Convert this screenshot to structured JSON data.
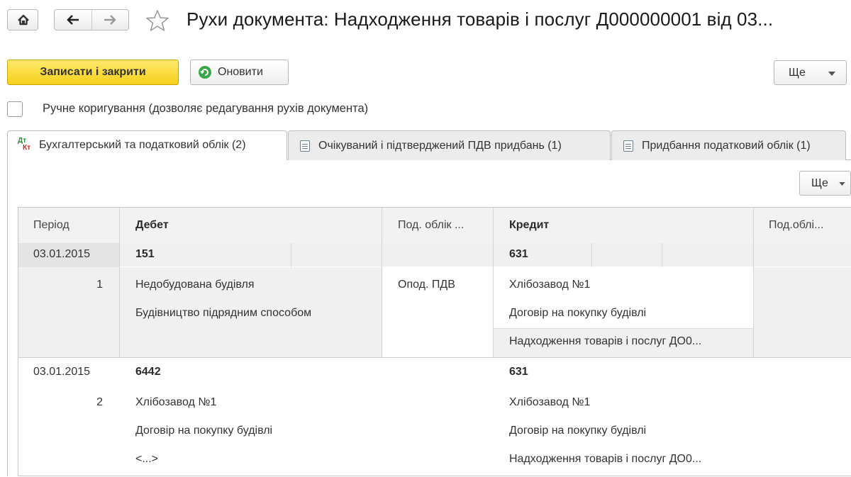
{
  "window": {
    "title": "Рухи документа: Надходження товарів і послуг Д000000001 від 03..."
  },
  "toolbar": {
    "save_close_label": "Записати і закрити",
    "refresh_label": "Оновити",
    "more_label": "Ще"
  },
  "manual": {
    "checked": false,
    "label": "Ручне коригування (дозволяє редагування рухів документа)"
  },
  "tabs": [
    {
      "label": "Бухгалтерський та податковий облік (2)",
      "icon": "dt-kt-icon",
      "active": true
    },
    {
      "label": "Очікуваний і підтверджений ПДВ придбань (1)",
      "icon": "register-icon",
      "active": false
    },
    {
      "label": "Придбання податковий облік (1)",
      "icon": "register-icon",
      "active": false
    }
  ],
  "table": {
    "more_label": "Ще",
    "columns": [
      "Період",
      "Дебет",
      "Под. облік ...",
      "Кредит",
      "Под.облі..."
    ],
    "rows": [
      {
        "period": "03.01.2015",
        "number": "1",
        "debit_account": "151",
        "debit_subconto": [
          "Недобудована будівля",
          "Будівництво підрядним способом"
        ],
        "tax_debit": "Опод. ПДВ",
        "credit_account": "631",
        "credit_subconto": [
          "Хлібозавод №1",
          "Договір на покупку будівлі",
          "Надходження товарів і послуг ДО0..."
        ]
      },
      {
        "period": "03.01.2015",
        "number": "2",
        "debit_account": "6442",
        "debit_subconto": [
          "Хлібозавод №1",
          "Договір на покупку будівлі",
          "<...>"
        ],
        "tax_debit": "",
        "credit_account": "631",
        "credit_subconto": [
          "Хлібозавод №1",
          "Договір на покупку будівлі",
          "Надходження товарів і послуг ДО0..."
        ]
      }
    ]
  },
  "colors": {
    "accent_yellow": "#f6d01c",
    "selected_row": "#f0f0f0",
    "refresh_green": "#3aa64a"
  }
}
